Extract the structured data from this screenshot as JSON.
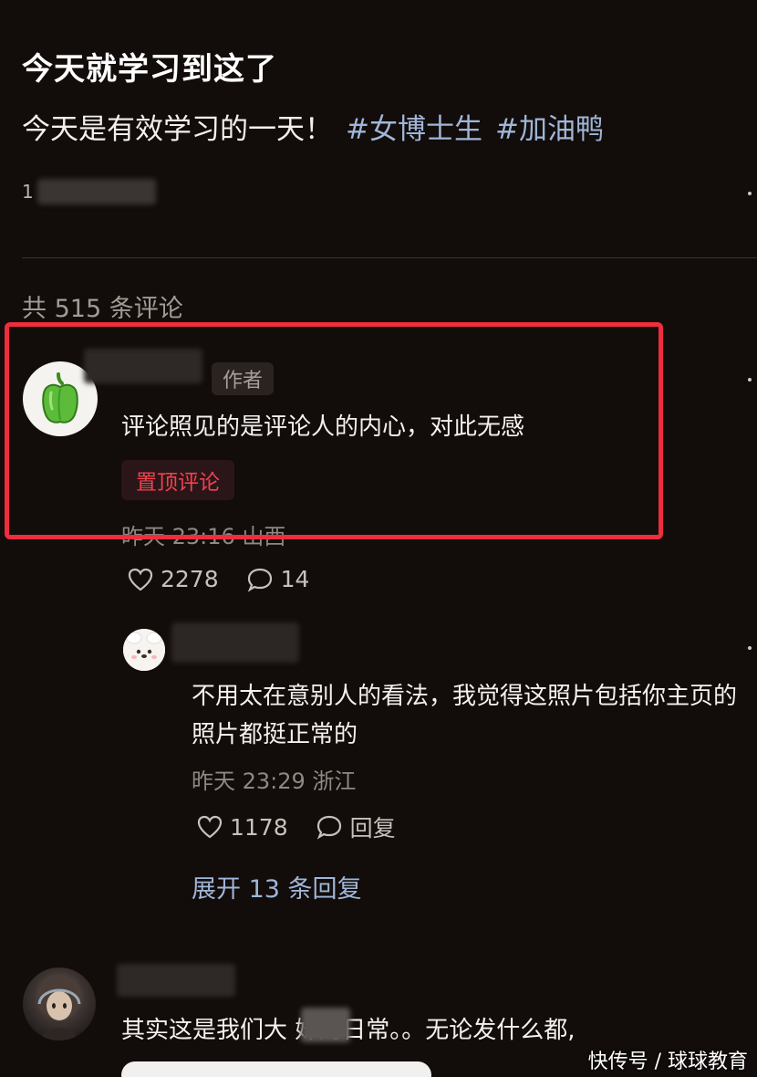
{
  "post": {
    "title": "今天就学习到这了",
    "body": "今天是有效学习的一天！",
    "hashtags": [
      "#女博士生",
      "#加油鸭"
    ],
    "meta_visible": "1"
  },
  "comments_header": {
    "count_label": "共 515 条评论"
  },
  "pinned_comment": {
    "author_tag": "作者",
    "text": "评论照见的是评论人的内心，对此无感",
    "pinned_label": "置顶评论",
    "time_location": "昨天 23:16 山西",
    "likes": "2278",
    "replies": "14",
    "avatar_icon": "green-pepper-icon"
  },
  "reply": {
    "text": "不用太在意别人的看法，我觉得这照片包括你主页的照片都挺正常的",
    "time_location": "昨天 23:29 浙江",
    "likes": "1178",
    "reply_label": "回复",
    "expand_label": "展开 13 条回复"
  },
  "third_comment": {
    "text": "其实这是我们大  妹的日常。。无论发什么都,"
  },
  "watermark": "快传号 / 球球教育",
  "colors": {
    "background": "#120c0a",
    "highlight_border": "#ee2d3d",
    "pinned_red": "#f0424e",
    "hashtag_blue": "#9fb6d8",
    "pepper_green": "#5dbb3a"
  }
}
